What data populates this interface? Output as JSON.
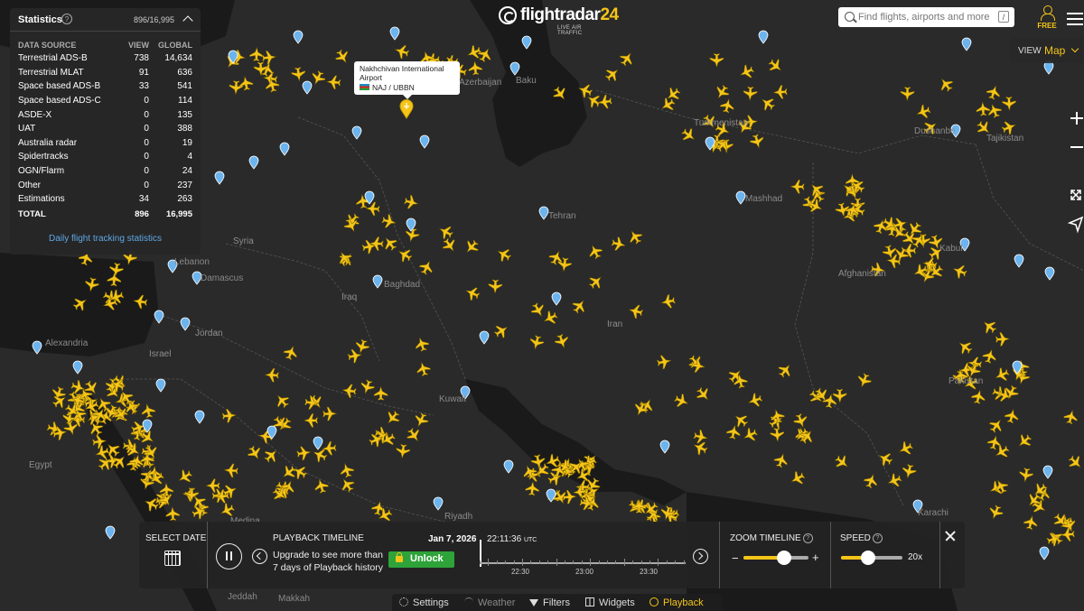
{
  "app": {
    "logo_text": "flightradar",
    "logo_number": "24",
    "logo_tagline": "LIVE AIR TRAFFIC"
  },
  "search": {
    "placeholder": "Find flights, airports and more",
    "shortcut": "/"
  },
  "account": {
    "label": "FREE"
  },
  "view": {
    "label": "VIEW",
    "value": "Map"
  },
  "statistics": {
    "title": "Statistics",
    "count": "896/16,995",
    "columns": [
      "DATA SOURCE",
      "VIEW",
      "GLOBAL"
    ],
    "rows": [
      {
        "source": "Terrestrial ADS-B",
        "view": "738",
        "global": "14,634"
      },
      {
        "source": "Terrestrial MLAT",
        "view": "91",
        "global": "636"
      },
      {
        "source": "Space based ADS-B",
        "view": "33",
        "global": "541"
      },
      {
        "source": "Space based ADS-C",
        "view": "0",
        "global": "114"
      },
      {
        "source": "ASDE-X",
        "view": "0",
        "global": "135"
      },
      {
        "source": "UAT",
        "view": "0",
        "global": "388"
      },
      {
        "source": "Australia radar",
        "view": "0",
        "global": "19"
      },
      {
        "source": "Spidertracks",
        "view": "0",
        "global": "4"
      },
      {
        "source": "OGN/Flarm",
        "view": "0",
        "global": "24"
      },
      {
        "source": "Other",
        "view": "0",
        "global": "237"
      },
      {
        "source": "Estimations",
        "view": "34",
        "global": "263"
      }
    ],
    "total": {
      "source": "TOTAL",
      "view": "896",
      "global": "16,995"
    },
    "link": "Daily flight tracking statistics"
  },
  "airport_tooltip": {
    "name": "Nakhchivan International Airport",
    "codes": "NAJ / UBBN"
  },
  "map_labels": [
    "Turkmenistan",
    "Tajikistan",
    "Afghanistan",
    "Iran",
    "Iraq",
    "Syria",
    "Jordan",
    "Israel",
    "Egypt",
    "Kuwait",
    "Tehran",
    "Baghdad",
    "Damascus",
    "Lebanon",
    "Alexandria",
    "Mashhad",
    "Kabul",
    "Dushanbe",
    "Baku",
    "Azerbaijan",
    "Pakistan",
    "Karachi",
    "Medina",
    "Riyadh",
    "Jeddah",
    "Makkah"
  ],
  "playback": {
    "select_date": "SELECT DATE",
    "title": "PLAYBACK TIMELINE",
    "upgrade_text": "Upgrade to see more than 7 days of Playback history",
    "unlock_label": "Unlock",
    "date": "Jan 7, 2026",
    "time": "22:11:36",
    "time_zone": "UTC",
    "timeline_labels": [
      "22:30",
      "23:00",
      "23:30"
    ],
    "zoom_label": "ZOOM TIMELINE",
    "zoom_level": 0.62,
    "speed_label": "SPEED",
    "speed_value": "20x",
    "speed_level": 0.44
  },
  "bottom_bar": {
    "settings": "Settings",
    "weather": "Weather",
    "filters": "Filters",
    "widgets": "Widgets",
    "playback": "Playback"
  },
  "colors": {
    "accent": "#f5c518",
    "map_background": "#2a2a2a",
    "aircraft": "#f5c518",
    "airport_pin": "#6cb4ee",
    "link": "#5fa8e6",
    "unlock": "#2ea33a"
  }
}
